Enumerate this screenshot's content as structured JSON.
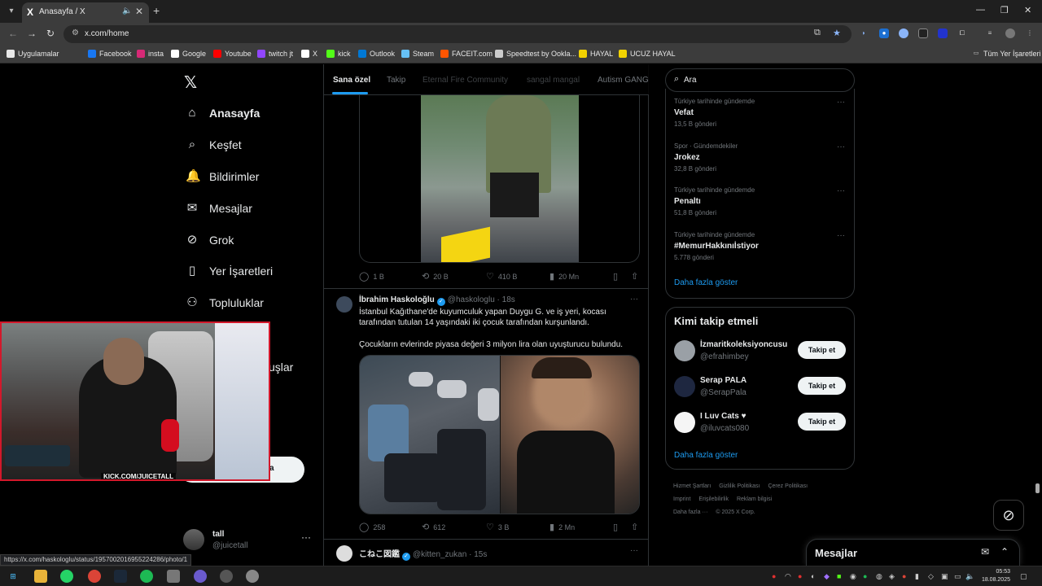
{
  "browser": {
    "tab": {
      "favicon": "X",
      "title": "Anasayfa / X"
    },
    "url": "x.com/home",
    "bookmarks": [
      {
        "label": "Uygulamalar",
        "color": "#e8e8e8",
        "icon": "apps-grid-icon"
      },
      {
        "label": "Facebook",
        "color": "#1877f2",
        "icon": "facebook-icon"
      },
      {
        "label": "insta",
        "color": "#d62976",
        "icon": "instagram-icon"
      },
      {
        "label": "Google",
        "color": "#ffffff",
        "icon": "google-icon"
      },
      {
        "label": "Youtube",
        "color": "#ff0000",
        "icon": "youtube-icon"
      },
      {
        "label": "twitch jt",
        "color": "#9146ff",
        "icon": "twitch-icon"
      },
      {
        "label": "X",
        "color": "#ffffff",
        "icon": "x-icon"
      },
      {
        "label": "kick",
        "color": "#53fc18",
        "icon": "kick-icon"
      },
      {
        "label": "Outlook",
        "color": "#0078d4",
        "icon": "outlook-icon"
      },
      {
        "label": "Steam",
        "color": "#66c0f4",
        "icon": "steam-icon"
      },
      {
        "label": "FACEIT.com",
        "color": "#ff5500",
        "icon": "faceit-icon"
      },
      {
        "label": "Speedtest by Ookla...",
        "color": "#cccccc",
        "icon": "speedtest-icon"
      },
      {
        "label": "HAYAL",
        "color": "#f2d200",
        "icon": "s-icon"
      },
      {
        "label": "UCUZ HAYAL",
        "color": "#f2d200",
        "icon": "s-icon"
      }
    ],
    "all_bookmarks": "Tüm Yer İşaretleri",
    "status_url": "https://x.com/haskologlu/status/1957002016955224286/photo/1"
  },
  "nav": {
    "items": [
      {
        "label": "Anasayfa",
        "icon": "home-icon",
        "glyph": "⌂"
      },
      {
        "label": "Keşfet",
        "icon": "search-icon",
        "glyph": "⌕"
      },
      {
        "label": "Bildirimler",
        "icon": "bell-icon",
        "glyph": "🔔"
      },
      {
        "label": "Mesajlar",
        "icon": "envelope-icon",
        "glyph": "✉"
      },
      {
        "label": "Grok",
        "icon": "grok-icon",
        "glyph": "⊘"
      },
      {
        "label": "Yer İşaretleri",
        "icon": "bookmark-icon",
        "glyph": "▯"
      },
      {
        "label": "Topluluklar",
        "icon": "communities-icon",
        "glyph": "⚇"
      }
    ],
    "partial_item": "uşlar",
    "post_button_partial": "a",
    "profile": {
      "name": "tall",
      "handle": "@juicetall"
    }
  },
  "webcam": {
    "label": "KICK.COM/JUICETALL"
  },
  "timeline": {
    "tabs": [
      "Sana özel",
      "Takip",
      "Eternal Fire Community",
      "sangal mangal",
      "Autism GANG"
    ],
    "tweet1_actions": {
      "replies": "1 B",
      "reposts": "20 B",
      "likes": "410 B",
      "views": "20 Mn"
    },
    "tweet2": {
      "name": "İbrahim Haskoloğlu",
      "handle": "@haskologlu",
      "time": "18s",
      "text1": "İstanbul Kağıthane'de kuyumculuk yapan Duygu G. ve iş yeri, kocası tarafından tutulan 14 yaşındaki iki çocuk tarafından kurşunlandı.",
      "text2": "Çocukların evlerinde piyasa değeri 3 milyon lira olan uyuşturucu bulundu.",
      "actions": {
        "replies": "258",
        "reposts": "612",
        "likes": "3 B",
        "views": "2 Mn"
      }
    },
    "tweet3": {
      "name": "こねこ図鑑",
      "handle": "@kitten_zukan",
      "time": "15s"
    }
  },
  "search": {
    "placeholder": "Ara"
  },
  "trends": [
    {
      "context": "Türkiye tarihinde gündemde",
      "name": "Vefat",
      "posts": "13,5 B gönderi"
    },
    {
      "context": "Spor · Gündemdekiler",
      "name": "Jrokez",
      "posts": "32,8 B gönderi"
    },
    {
      "context": "Türkiye tarihinde gündemde",
      "name": "Penaltı",
      "posts": "51,8 B gönderi"
    },
    {
      "context": "Türkiye tarihinde gündemde",
      "name": "#MemurHakkınıİstiyor",
      "posts": "5.778 gönderi"
    }
  ],
  "trends_show_more": "Daha fazla göster",
  "who_to_follow": {
    "title": "Kimi takip etmeli",
    "users": [
      {
        "name": "İzmaritkoleksiyoncusu",
        "handle": "@efrahimbey",
        "button": "Takip et"
      },
      {
        "name": "Serap PALA",
        "handle": "@SerapPala",
        "button": "Takip et"
      },
      {
        "name": "I Luv Cats ♥",
        "handle": "@iluvcats080",
        "button": "Takip et"
      }
    ],
    "show_more": "Daha fazla göster"
  },
  "footer": [
    "Hizmet Şartları",
    "Gizlilik Politikası",
    "Çerez Politikası",
    "Imprint",
    "Erişilebilirlik",
    "Reklam bilgisi",
    "Daha fazla ···",
    "© 2025 X Corp."
  ],
  "messages_drawer": {
    "title": "Mesajlar"
  },
  "clock": {
    "time": "05:53",
    "date": "18.08.2025"
  }
}
